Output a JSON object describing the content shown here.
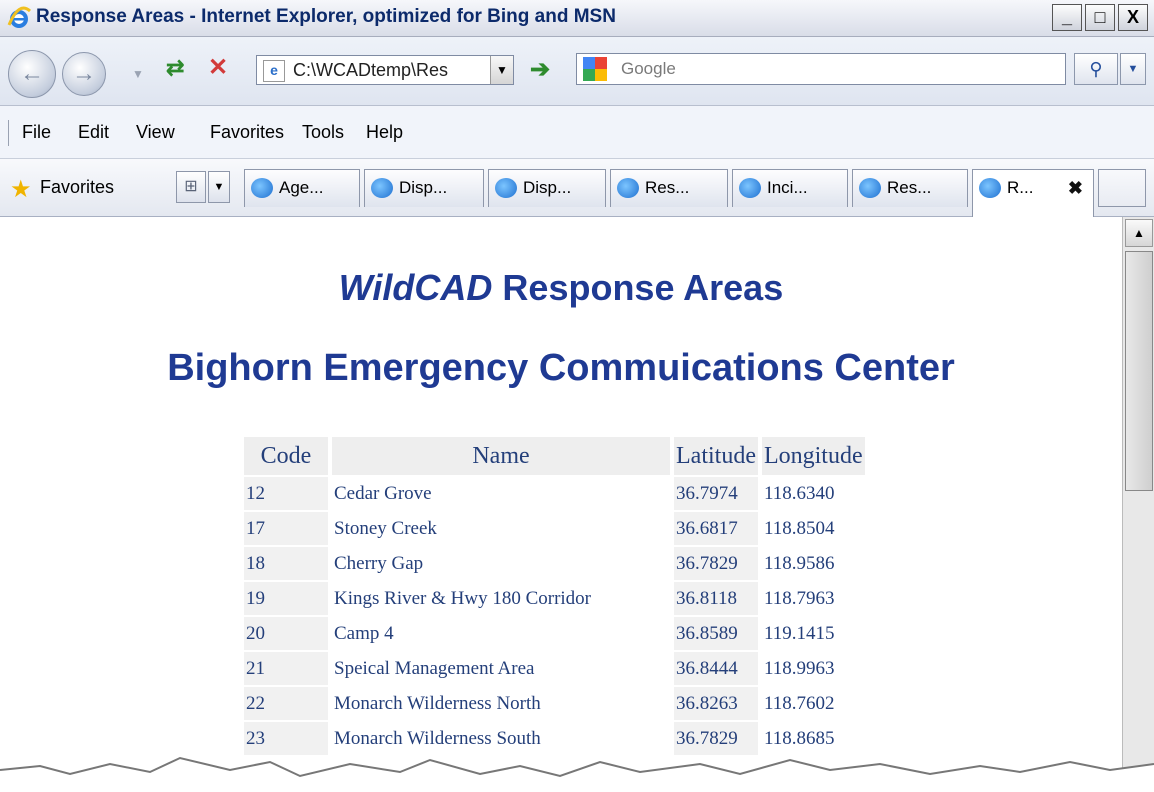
{
  "window": {
    "title": "Response Areas - Internet Explorer, optimized for Bing and MSN",
    "buttons": [
      "_",
      "□",
      "X"
    ]
  },
  "address_bar": {
    "url": "C:\\WCADtemp\\Res",
    "search_placeholder": "Google"
  },
  "menu": [
    "File",
    "Edit",
    "View",
    "Favorites",
    "Tools",
    "Help"
  ],
  "favorites_bar": {
    "label": "Favorites",
    "tabs": [
      "Age...",
      "Disp...",
      "Disp...",
      "Res...",
      "Inci...",
      "Res...",
      "R..."
    ]
  },
  "page": {
    "title_italic": "WildCAD",
    "title_rest": " Response Areas",
    "subtitle": "Bighorn Emergency Commuications Center",
    "table": {
      "headers": [
        "Code",
        "Name",
        "Latitude",
        "Longitude"
      ],
      "rows": [
        [
          "12",
          "Cedar Grove",
          "36.7974",
          "118.6340"
        ],
        [
          "17",
          "Stoney Creek",
          "36.6817",
          "118.8504"
        ],
        [
          "18",
          "Cherry Gap",
          "36.7829",
          "118.9586"
        ],
        [
          "19",
          "Kings River & Hwy 180 Corridor",
          "36.8118",
          "118.7963"
        ],
        [
          "20",
          "Camp 4",
          "36.8589",
          "119.1415"
        ],
        [
          "21",
          "Speical Management Area",
          "36.8444",
          "118.9963"
        ],
        [
          "22",
          "Monarch Wilderness North",
          "36.8263",
          "118.7602"
        ],
        [
          "23",
          "Monarch Wilderness South",
          "36.7829",
          "118.8685"
        ]
      ]
    }
  },
  "colors": {
    "heading": "#1f3a93",
    "table_text": "#243f7a"
  }
}
